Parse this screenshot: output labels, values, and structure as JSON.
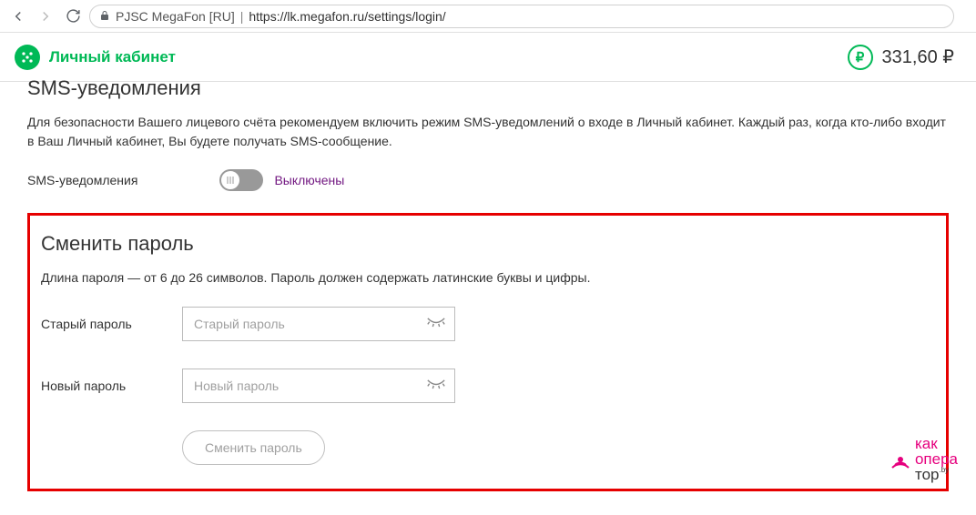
{
  "browser": {
    "publisher": "PJSC MegaFon [RU]",
    "url": "https://lk.megafon.ru/settings/login/"
  },
  "header": {
    "brand": "Личный кабинет",
    "currency_symbol": "₽",
    "balance": "331,60 ₽"
  },
  "sms_section": {
    "title": "SMS-уведомления",
    "description": "Для безопасности Вашего лицевого счёта рекомендуем включить режим SMS-уведомлений о входе в Личный кабинет. Каждый раз, когда кто-либо входит в Ваш Личный кабинет, Вы будете получать SMS-сообщение.",
    "toggle_label": "SMS-уведомления",
    "toggle_status": "Выключены"
  },
  "password_section": {
    "title": "Сменить пароль",
    "hint": "Длина пароля — от 6 до 26 символов. Пароль должен содержать латинские буквы и цифры.",
    "old_password_label": "Старый пароль",
    "old_password_placeholder": "Старый пароль",
    "new_password_label": "Новый пароль",
    "new_password_placeholder": "Новый пароль",
    "button": "Сменить пароль"
  },
  "watermark": {
    "line1": "как",
    "line2": "опера",
    "line3": "тор",
    "suffix": ".by"
  }
}
